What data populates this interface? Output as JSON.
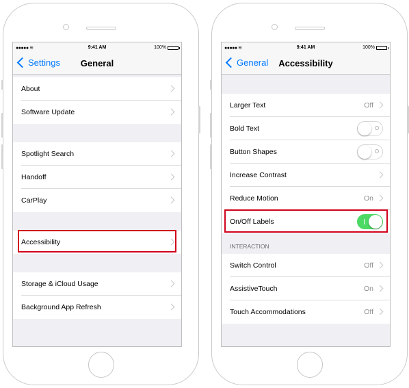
{
  "status": {
    "time": "9:41 AM",
    "battery": "100%",
    "signal": "●●●●● ≋"
  },
  "left": {
    "back_label": "Settings",
    "title": "General",
    "rows": [
      {
        "label": "About"
      },
      {
        "label": "Software Update"
      },
      {
        "label": "Spotlight Search"
      },
      {
        "label": "Handoff"
      },
      {
        "label": "CarPlay"
      },
      {
        "label": "Accessibility"
      },
      {
        "label": "Storage & iCloud Usage"
      },
      {
        "label": "Background App Refresh"
      }
    ]
  },
  "right": {
    "back_label": "General",
    "title": "Accessibility",
    "section_header": "INTERACTION",
    "rows": [
      {
        "label": "Larger Text",
        "value": "Off"
      },
      {
        "label": "Bold Text",
        "toggle": "off"
      },
      {
        "label": "Button Shapes",
        "toggle": "off"
      },
      {
        "label": "Increase Contrast"
      },
      {
        "label": "Reduce Motion",
        "value": "On"
      },
      {
        "label": "On/Off Labels",
        "toggle": "on"
      },
      {
        "label": "Switch Control",
        "value": "Off"
      },
      {
        "label": "AssistiveTouch",
        "value": "On"
      },
      {
        "label": "Touch Accommodations",
        "value": "Off"
      }
    ]
  },
  "colors": {
    "accent": "#007aff",
    "highlight": "#d0021b",
    "toggle_on": "#4cd964",
    "background": "#efeff4"
  }
}
